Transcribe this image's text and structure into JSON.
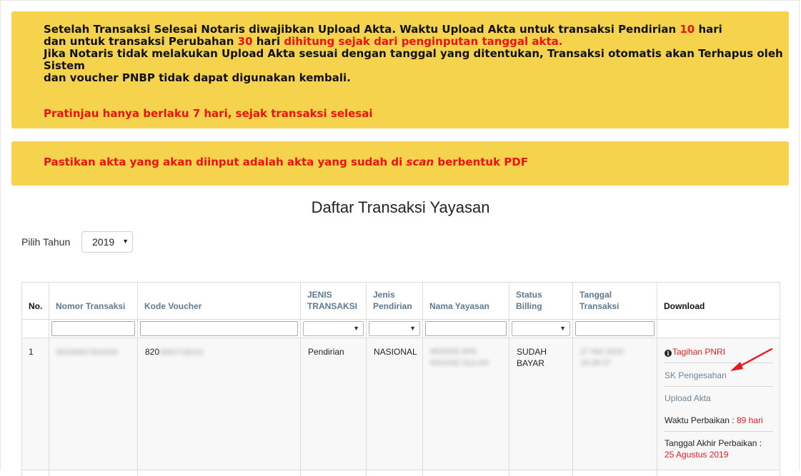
{
  "notice": {
    "line1_a": "Setelah Transaksi Selesai Notaris diwajibkan Upload Akta. Waktu Upload Akta untuk transaksi Pendirian ",
    "line1_days": "10",
    "line1_b": " hari",
    "line2_a": "dan untuk transaksi Perubahan ",
    "line2_days": "30",
    "line2_b": " hari ",
    "line2_red": "dihitung sejak dari penginputan tanggal akta.",
    "line3": "Jika Notaris tidak melakukan Upload Akta sesuai dengan tanggal yang ditentukan, Transaksi otomatis akan Terhapus oleh Sistem",
    "line4": "dan voucher PNBP tidak dapat digunakan kembali.",
    "preview": "Pratinjau hanya berlaku 7 hari, sejak transaksi selesai"
  },
  "notice2": {
    "text_a": "Pastikan akta yang akan diinput adalah akta yang sudah di ",
    "text_em": "scan",
    "text_b": " berbentuk PDF"
  },
  "page_title": "Daftar Transaksi Yayasan",
  "year_filter": {
    "label": "Pilih Tahun",
    "value": "2019"
  },
  "table": {
    "headers": [
      "No.",
      "Nomor Transaksi",
      "Kode Voucher",
      "JENIS TRANSAKSI",
      "Jenis Pendirian",
      "Nama Yayasan",
      "Status Billing",
      "Tanggal Transaksi",
      "Download"
    ],
    "row": {
      "no": "1",
      "nomor_transaksi": "50160927341500",
      "kode_voucher_prefix": "820",
      "kode_voucher_rest": "9062716010",
      "jenis_transaksi": "Pendirian",
      "jenis_pendirian": "NASIONAL",
      "nama_yayasan": "MOHDE APA NSOSID SULAN",
      "status_billing": "SUDAH BAYAR",
      "tanggal_transaksi": "27 Mei 2019 16:38:37",
      "download": {
        "tagihan": "Tagihan PNRI",
        "sk": "SK Pengesahan",
        "upload": "Upload Akta",
        "waktu_label": "Waktu Perbaikan : ",
        "waktu_value": "89 hari",
        "tanggal_label": "Tanggal Akhir Perbaikan : ",
        "tanggal_value": "25 Agustus 2019"
      }
    }
  },
  "colors": {
    "notice_bg": "#f6d34c",
    "red": "#ee1111",
    "header_text": "#5c7a94",
    "status_green": "#2e8b2e"
  }
}
